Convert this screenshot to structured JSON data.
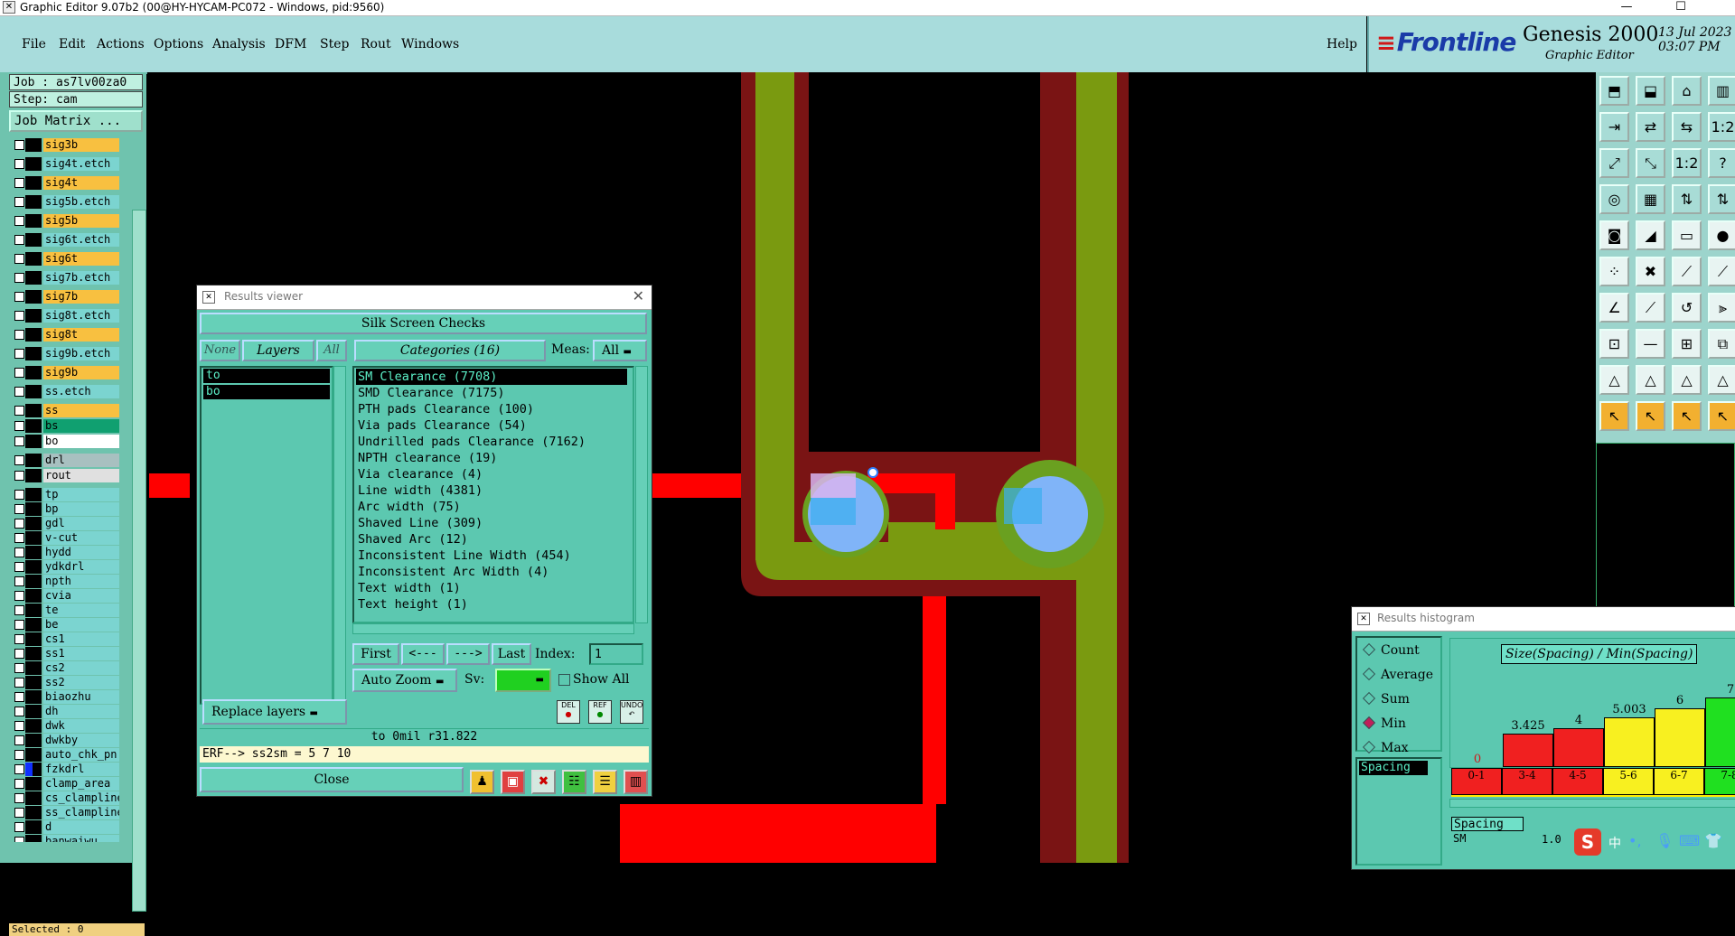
{
  "window": {
    "title": "Graphic Editor 9.07b2 (00@HY-HYCAM-PC072 - Windows, pid:9560)",
    "minimize": "—",
    "maximize": "☐",
    "close": "✕"
  },
  "menu": [
    "File",
    "Edit",
    "Actions",
    "Options",
    "Analysis",
    "DFM",
    "Step",
    "Rout",
    "Windows"
  ],
  "help": "Help",
  "brand": {
    "logo": "Frontline",
    "product": "Genesis 2000",
    "subtitle": "Graphic Editor",
    "date": "13 Jul 2023",
    "time": "03:07 PM"
  },
  "left_panel": {
    "job": "Job : as7lv00za0",
    "step": "Step: cam",
    "job_matrix": "Job Matrix ...",
    "selected": "Selected : 0",
    "layers": [
      {
        "name": "sig3b",
        "color": "#f8c040"
      },
      {
        "name": "sig4t.etch",
        "color": "#7bd4d0"
      },
      {
        "name": "sig4t",
        "color": "#f8c040"
      },
      {
        "name": "sig5b.etch",
        "color": "#7bd4d0"
      },
      {
        "name": "sig5b",
        "color": "#f8c040"
      },
      {
        "name": "sig6t.etch",
        "color": "#7bd4d0"
      },
      {
        "name": "sig6t",
        "color": "#f8c040"
      },
      {
        "name": "sig7b.etch",
        "color": "#7bd4d0"
      },
      {
        "name": "sig7b",
        "color": "#f8c040"
      },
      {
        "name": "sig8t.etch",
        "color": "#7bd4d0"
      },
      {
        "name": "sig8t",
        "color": "#f8c040"
      },
      {
        "name": "sig9b.etch",
        "color": "#7bd4d0"
      },
      {
        "name": "sig9b",
        "color": "#f8c040"
      },
      {
        "name": "ss.etch",
        "color": "#7bd4d0"
      },
      {
        "name": "ss",
        "color": "#f8c040"
      },
      {
        "name": "bs",
        "color": "#10a070"
      },
      {
        "name": "bo",
        "color": "#ffffff"
      },
      {
        "name": "drl",
        "color": "#a8c0c0"
      },
      {
        "name": "rout",
        "color": "#e0e0e0"
      },
      {
        "name": "tp",
        "color": "#7bd4d0"
      },
      {
        "name": "bp",
        "color": "#7bd4d0"
      },
      {
        "name": "gdl",
        "color": "#7bd4d0"
      },
      {
        "name": "v-cut",
        "color": "#7bd4d0"
      },
      {
        "name": "hydd",
        "color": "#7bd4d0"
      },
      {
        "name": "ydkdrl",
        "color": "#7bd4d0"
      },
      {
        "name": "npth",
        "color": "#7bd4d0"
      },
      {
        "name": "cvia",
        "color": "#7bd4d0"
      },
      {
        "name": "te",
        "color": "#7bd4d0"
      },
      {
        "name": "be",
        "color": "#7bd4d0"
      },
      {
        "name": "cs1",
        "color": "#7bd4d0"
      },
      {
        "name": "ss1",
        "color": "#7bd4d0"
      },
      {
        "name": "cs2",
        "color": "#7bd4d0"
      },
      {
        "name": "ss2",
        "color": "#7bd4d0"
      },
      {
        "name": "biaozhu",
        "color": "#7bd4d0"
      },
      {
        "name": "dh",
        "color": "#7bd4d0"
      },
      {
        "name": "dwk",
        "color": "#7bd4d0"
      },
      {
        "name": "dwkby",
        "color": "#7bd4d0"
      },
      {
        "name": "auto_chk_pn",
        "color": "#7bd4d0"
      },
      {
        "name": "fzkdrl",
        "color": "#7bd4d0"
      },
      {
        "name": "clamp_area",
        "color": "#7bd4d0"
      },
      {
        "name": "cs_clampline",
        "color": "#7bd4d0"
      },
      {
        "name": "ss_clampline",
        "color": "#7bd4d0"
      },
      {
        "name": "d",
        "color": "#7bd4d0"
      },
      {
        "name": "banwaiwu",
        "color": "#7bd4d0"
      }
    ]
  },
  "results_viewer": {
    "title": "Results viewer",
    "header": "Silk Screen Checks",
    "none": "None",
    "layers_label": "Layers",
    "all": "All",
    "categories_label": "Categories (16)",
    "meas_label": "Meas:",
    "meas_value": "All",
    "layers": [
      "to",
      "bo"
    ],
    "categories": [
      "SM Clearance (7708)",
      "SMD Clearance (7175)",
      "PTH pads Clearance (100)",
      "Via pads Clearance (54)",
      "Undrilled pads Clearance (7162)",
      "NPTH clearance (19)",
      "Via clearance (4)",
      "Line width (4381)",
      "Arc width (75)",
      "Shaved Line (309)",
      "Shaved Arc (12)",
      "Inconsistent Line Width (454)",
      "Inconsistent Arc Width (4)",
      "Text width (1)",
      "Text height (1)"
    ],
    "first": "First",
    "prev": "<---",
    "next": "--->",
    "last": "Last",
    "index_label": "Index:",
    "index_value": "1",
    "auto_zoom": "Auto Zoom",
    "sv_label": "Sv:",
    "show_all": "Show All",
    "replace_layers": "Replace layers",
    "del": "DEL",
    "ref": "REF",
    "undo": "UNDO",
    "status1": "to 0mil  r31.822",
    "status2": "ERF--> ss2sm = 5 7 10",
    "close": "Close"
  },
  "histogram": {
    "title": "Results histogram",
    "modes": [
      "Count",
      "Average",
      "Sum",
      "Min",
      "Max"
    ],
    "selected_mode": "Min",
    "measure_list_item": "Spacing",
    "graph_title": "Size(Spacing) / Min(Spacing)",
    "bottom_label": "Spacing",
    "bottom_sub": "SM",
    "bottom_value": "1.0",
    "bars": [
      {
        "range": "0-1",
        "value": "0",
        "level": 0,
        "color": "#e82020"
      },
      {
        "range": "3-4",
        "value": "3.425",
        "level": 0.39,
        "color": "#f02020"
      },
      {
        "range": "4-5",
        "value": "4",
        "level": 0.45,
        "color": "#f02020"
      },
      {
        "range": "5-6",
        "value": "5.003",
        "level": 0.57,
        "color": "#f8f020"
      },
      {
        "range": "6-7",
        "value": "6",
        "level": 0.68,
        "color": "#f8f020"
      },
      {
        "range": "7-8",
        "value": "7",
        "level": 0.8,
        "color": "#20e020"
      }
    ]
  },
  "colors": {
    "panel": "#a8dcdc",
    "dialog": "#5cc8b0",
    "trace_red": "#ff0000",
    "silk_dark_red": "#7a1414",
    "olive": "#7a9a10",
    "pad_blue": "#80b4f8"
  }
}
